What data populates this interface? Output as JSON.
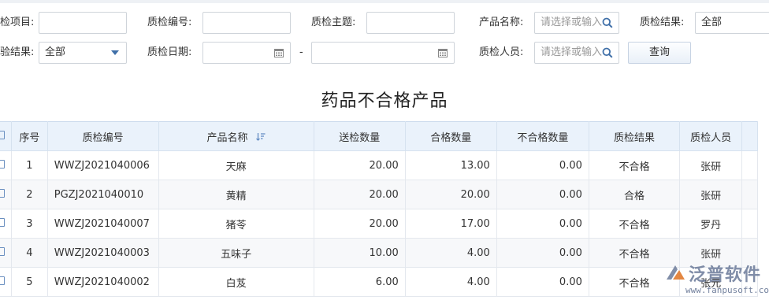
{
  "filters": {
    "row1": {
      "item_label": "检项目:",
      "code_label": "质检编号:",
      "topic_label": "质检主题:",
      "product_label": "产品名称:",
      "product_placeholder": "请选择或输入",
      "result_label": "质检结果:",
      "result_value": "全部"
    },
    "row2": {
      "prev_result_label": "验结果:",
      "prev_result_value": "全部",
      "date_label": "质检日期:",
      "date_separator": "-",
      "person_label": "质检人员:",
      "person_placeholder": "请选择或输入",
      "query_button": "查询"
    }
  },
  "report_title": "药品不合格产品",
  "table": {
    "headers": {
      "seq": "序号",
      "code": "质检编号",
      "product": "产品名称",
      "sent_qty": "送检数量",
      "pass_qty": "合格数量",
      "fail_qty": "不合格数量",
      "result": "质检结果",
      "person": "质检人员"
    },
    "rows": [
      {
        "seq": "1",
        "code": "WWZJ2021040006",
        "product": "天麻",
        "sent_qty": "20.00",
        "pass_qty": "13.00",
        "fail_qty": "0.00",
        "result": "不合格",
        "person": "张研"
      },
      {
        "seq": "2",
        "code": "PGZJ2021040010",
        "product": "黄精",
        "sent_qty": "20.00",
        "pass_qty": "20.00",
        "fail_qty": "0.00",
        "result": "合格",
        "person": "张研"
      },
      {
        "seq": "3",
        "code": "WWZJ2021040007",
        "product": "猪苓",
        "sent_qty": "20.00",
        "pass_qty": "17.00",
        "fail_qty": "0.00",
        "result": "不合格",
        "person": "罗丹"
      },
      {
        "seq": "4",
        "code": "WWZJ2021040003",
        "product": "五味子",
        "sent_qty": "10.00",
        "pass_qty": "4.00",
        "fail_qty": "0.00",
        "result": "不合格",
        "person": "张研"
      },
      {
        "seq": "5",
        "code": "WWZJ2021040002",
        "product": "白芨",
        "sent_qty": "6.00",
        "pass_qty": "4.00",
        "fail_qty": "0.00",
        "result": "不合格",
        "person": "张元"
      }
    ]
  },
  "watermark": {
    "brand": "泛普软件",
    "url": "www.fanpusoft.com"
  },
  "colors": {
    "link": "#3a6fb5",
    "fail": "#e02020",
    "pass": "#179a2c",
    "header_bg": "#eaf2fb"
  }
}
